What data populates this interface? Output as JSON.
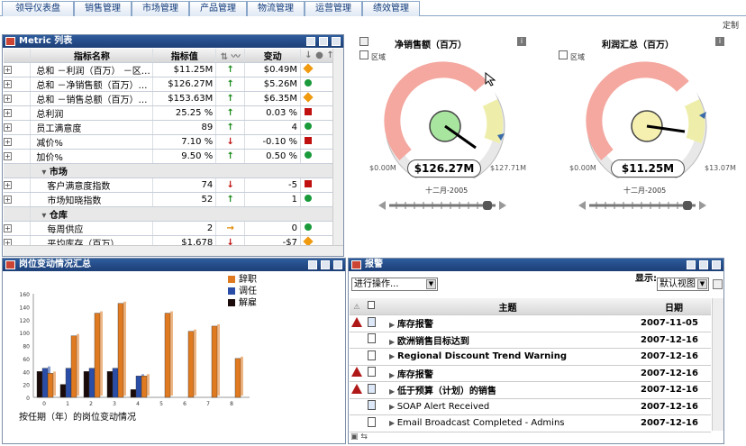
{
  "tabs": [
    "领导仪表盘",
    "销售管理",
    "市场管理",
    "产品管理",
    "物流管理",
    "运营管理",
    "绩效管理"
  ],
  "customize_label": "定制",
  "metric_panel": {
    "title": "Metric 列表",
    "columns": [
      "指标名称",
      "指标值",
      "变动"
    ],
    "rows": [
      {
        "name": "总和 －利润（百万） －区…",
        "value": "$11.25M",
        "trend": "↑",
        "change": "$0.49M",
        "status": "diamond"
      },
      {
        "name": "总和 －净销售额（百万）…",
        "value": "$126.27M",
        "trend": "↑",
        "change": "$5.26M",
        "status": "circle"
      },
      {
        "name": "总和 －销售总额（百万）…",
        "value": "$153.63M",
        "trend": "↑",
        "change": "$6.35M",
        "status": "diamond"
      },
      {
        "name": "总利润",
        "value": "25.25 %",
        "trend": "↑",
        "change": "0.03 %",
        "status": "square"
      },
      {
        "name": "员工满意度",
        "value": "89",
        "trend": "↑",
        "change": "4",
        "status": "circle"
      },
      {
        "name": "减价%",
        "value": "7.10 %",
        "trend": "↓",
        "change": "-0.10 %",
        "status": "square"
      },
      {
        "name": "加价%",
        "value": "9.50 %",
        "trend": "↑",
        "change": "0.50 %",
        "status": "circle"
      },
      {
        "group": "市场"
      },
      {
        "name": "客户满意度指数",
        "value": "74",
        "trend": "↓",
        "change": "-5",
        "status": "square"
      },
      {
        "name": "市场知晓指数",
        "value": "52",
        "trend": "↑",
        "change": "1",
        "status": "circle"
      },
      {
        "group": "仓库"
      },
      {
        "name": "每周供应",
        "value": "2",
        "trend": "→",
        "change": "0",
        "status": "circle"
      },
      {
        "name": "平均库存（百万）",
        "value": "$1.678",
        "trend": "↓",
        "change": "-$7",
        "status": "diamond"
      }
    ]
  },
  "gauges": [
    {
      "title": "净销售额（百万）",
      "area_label": "区域",
      "value": "$126.27M",
      "min": "$0.00M",
      "max": "$127.71M",
      "date": "十二月-2005"
    },
    {
      "title": "利润汇总（百万）",
      "area_label": "区域",
      "value": "$11.25M",
      "min": "$0.00M",
      "max": "$13.07M",
      "date": "十二月-2005"
    }
  ],
  "chart_panel": {
    "title": "岗位变动情况汇总"
  },
  "chart_data": {
    "type": "bar",
    "categories": [
      "0",
      "1",
      "2",
      "3",
      "4",
      "5",
      "6",
      "7",
      "8"
    ],
    "series": [
      {
        "name": "辞职",
        "color": "#e07a20",
        "values": [
          37,
          95,
          130,
          145,
          33,
          130,
          102,
          110,
          60
        ]
      },
      {
        "name": "调任",
        "color": "#2a4ea8",
        "values": [
          45,
          45,
          45,
          45,
          33,
          0,
          0,
          0,
          0
        ]
      },
      {
        "name": "解雇",
        "color": "#1a0a0a",
        "values": [
          40,
          20,
          40,
          40,
          12,
          0,
          0,
          0,
          0
        ]
      }
    ],
    "ylim": [
      0,
      160
    ],
    "yticks": [
      "0",
      "20",
      "40",
      "60",
      "80",
      "100",
      "120",
      "140",
      "160"
    ],
    "xlabel": "按任期（年）的岗位变动情况",
    "legend_position": "top-right"
  },
  "alerts_panel": {
    "title": "报警",
    "action_select": "进行操作...",
    "display_label": "显示:",
    "view_select": "默认视图",
    "columns": [
      "主题",
      "日期"
    ],
    "rows": [
      {
        "warn": true,
        "icon": "doc-check",
        "subject": "库存报警",
        "date": "2007-11-05",
        "bold": true
      },
      {
        "warn": false,
        "icon": "doc",
        "subject": "欧洲销售目标达到",
        "date": "2007-12-16",
        "bold": true
      },
      {
        "warn": false,
        "icon": "doc",
        "subject": "Regional Discount Trend Warning",
        "date": "2007-12-16",
        "bold": true
      },
      {
        "warn": true,
        "icon": "doc",
        "subject": "库存报警",
        "date": "2007-12-16",
        "bold": true
      },
      {
        "warn": true,
        "icon": "doc-check",
        "subject": "低于预算（计划）的销售",
        "date": "2007-12-16",
        "bold": true
      },
      {
        "warn": false,
        "icon": "doc-check",
        "subject": "SOAP Alert Received",
        "date": "2007-12-16",
        "bold": false
      },
      {
        "warn": false,
        "icon": "doc",
        "subject": "Email Broadcast Completed - Admins",
        "date": "2007-12-16",
        "bold": false
      }
    ]
  }
}
